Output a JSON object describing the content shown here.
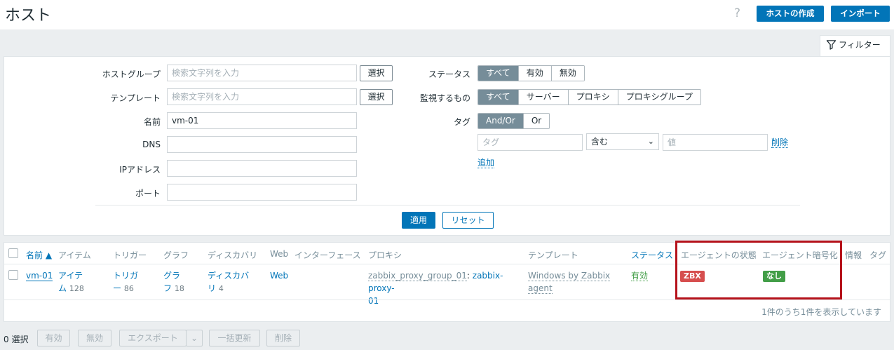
{
  "header": {
    "title": "ホスト",
    "help": "?",
    "create_host": "ホストの作成",
    "import": "インポート"
  },
  "filter": {
    "tab_label": "フィルター",
    "host_group_label": "ホストグループ",
    "host_group_placeholder": "検索文字列を入力",
    "template_label": "テンプレート",
    "template_placeholder": "検索文字列を入力",
    "select_button": "選択",
    "name_label": "名前",
    "name_value": "vm-01",
    "dns_label": "DNS",
    "ip_label": "IPアドレス",
    "port_label": "ポート",
    "status_label": "ステータス",
    "status_options": [
      "すべて",
      "有効",
      "無効"
    ],
    "monitored_by_label": "監視するもの",
    "monitored_by_options": [
      "すべて",
      "サーバー",
      "プロキシ",
      "プロキシグループ"
    ],
    "tags_label": "タグ",
    "tags_options": [
      "And/Or",
      "Or"
    ],
    "tag_placeholder": "タグ",
    "tag_operator": "含む",
    "value_placeholder": "値",
    "remove_link": "削除",
    "add_link": "追加",
    "apply": "適用",
    "reset": "リセット"
  },
  "table": {
    "columns": [
      "名前 ▲",
      "アイテム",
      "トリガー",
      "グラフ",
      "ディスカバリ",
      "Web",
      "インターフェース",
      "プロキシ",
      "テンプレート",
      "ステータス",
      "エージェントの状態",
      "エージェント暗号化",
      "情報",
      "タグ"
    ],
    "row": {
      "name": "vm-01",
      "items_label_1": "アイテ",
      "items_label_2": "ム",
      "items_count": "128",
      "triggers_label_1": "トリガ",
      "triggers_label_2": "ー",
      "triggers_count": "86",
      "graphs_label_1": "グラ",
      "graphs_label_2": "フ",
      "graphs_count": "18",
      "discovery_label_1": "ディスカバ",
      "discovery_label_2": "リ",
      "discovery_count": "4",
      "web": "Web",
      "proxy_group": "zabbix_proxy_group_01",
      "proxy_sep": ":",
      "proxy_1": "zabbix-proxy-",
      "proxy_2": "01",
      "template_1": "Windows by Zabbix",
      "template_2": "agent",
      "status": "有効",
      "agent_state": "ZBX",
      "agent_encryption": "なし"
    },
    "footer": "1件のうち1件を表示しています"
  },
  "bottom": {
    "selected": "0 選択",
    "enable": "有効",
    "disable": "無効",
    "export": "エクスポート",
    "mass_update": "一括更新",
    "delete": "削除"
  },
  "colors": {
    "primary": "#0275b8",
    "badge_red": "#d64e4e",
    "badge_green": "#429e47",
    "highlight": "#b5121b"
  }
}
